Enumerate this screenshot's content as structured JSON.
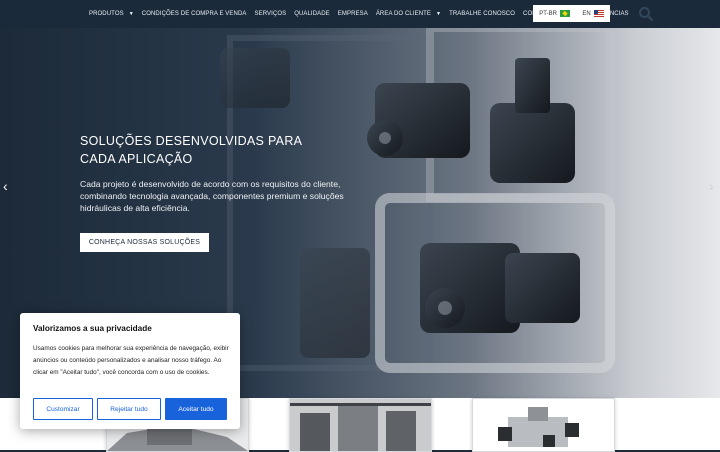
{
  "nav": {
    "items": [
      {
        "label": "PRODUTOS",
        "has_dropdown": true
      },
      {
        "label": "CONDIÇÕES DE COMPRA E VENDA",
        "has_dropdown": false
      },
      {
        "label": "SERVIÇOS",
        "has_dropdown": false
      },
      {
        "label": "QUALIDADE",
        "has_dropdown": false
      },
      {
        "label": "EMPRESA",
        "has_dropdown": false
      },
      {
        "label": "ÁREA DO CLIENTE",
        "has_dropdown": true
      },
      {
        "label": "TRABALHE CONOSCO",
        "has_dropdown": false
      },
      {
        "label": "CONTATO",
        "has_dropdown": false
      },
      {
        "label": "CANAL DE DENÚNCIAS",
        "has_dropdown": false
      }
    ],
    "languages": [
      {
        "code": "PT-BR",
        "flag": "brazil-flag"
      },
      {
        "code": "EN",
        "flag": "usa-flag"
      }
    ],
    "search_icon": "search-icon"
  },
  "hero": {
    "title": "SOLUÇÕES DESENVOLVIDAS PARA CADA APLICAÇÃO",
    "text": "Cada projeto é desenvolvido de acordo com os requisitos do cliente, combinando tecnologia avançada, componentes premium e soluções hidráulicas de alta eficiência.",
    "cta": "CONHEÇA NOSSAS SOLUÇÕES",
    "prev_icon": "chevron-left-icon",
    "next_icon": "chevron-right-icon"
  },
  "cookie": {
    "title": "Valorizamos a sua privacidade",
    "text": "Usamos cookies para melhorar sua experiência de navegação, exibir anúncios ou conteúdo personalizados e analisar nosso tráfego. Ao clicar em \"Aceitar tudo\", você concorda com o uso de cookies.",
    "customize": "Customizar",
    "reject": "Rejeitar tudo",
    "accept": "Aceitar tudo"
  },
  "colors": {
    "nav_bg": "#1b2a3a",
    "cookie_accent": "#1863dc"
  }
}
